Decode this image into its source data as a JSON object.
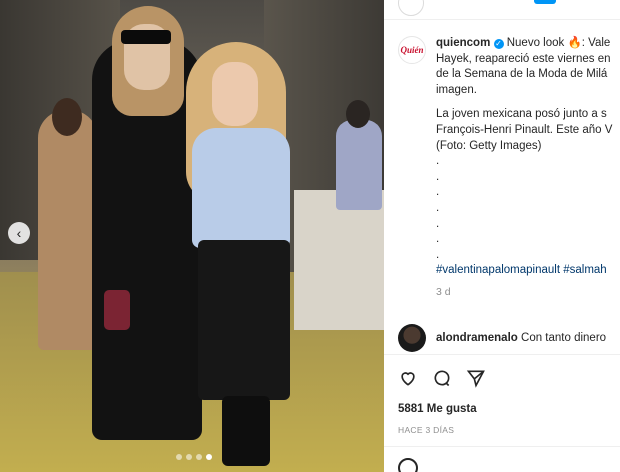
{
  "post": {
    "image_dots": 4,
    "active_dot": 3,
    "prev_arrow": "‹"
  },
  "caption": {
    "avatar_text": "Quién",
    "username": "quiencom",
    "lines": [
      "Nuevo look 🔥: Vale",
      "Hayek, reapareció este viernes en",
      "de la Semana de la Moda de Milá",
      "imagen.",
      "",
      "La joven mexicana posó junto a s",
      "François-Henri Pinault. Este año V",
      "(Foto: Getty Images)",
      ".",
      ".",
      ".",
      ".",
      ".",
      ".",
      "."
    ],
    "hashtags": "#valentinapalomapinault #salmah",
    "time": "3 d"
  },
  "comment": {
    "username": "alondramenalo",
    "text": "Con tanto dinero"
  },
  "likes": "5881 Me gusta",
  "posted_ago": "HACE 3 DÍAS",
  "colors": {
    "link": "#00376b",
    "verified": "#0095f6",
    "brand": "#c8102e"
  }
}
